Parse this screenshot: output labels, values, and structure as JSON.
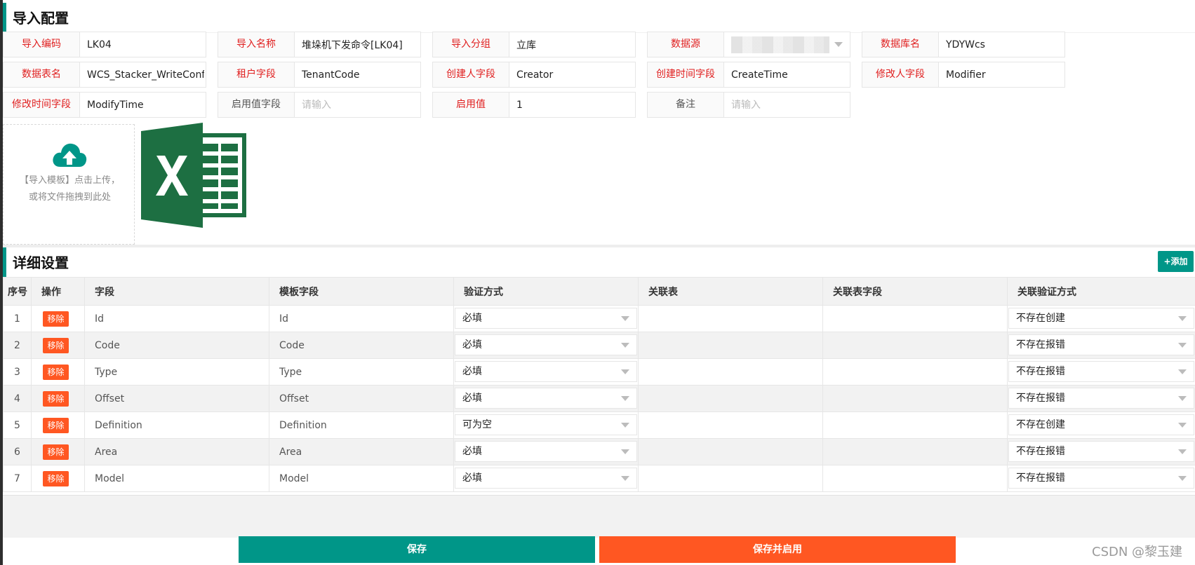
{
  "import_config": {
    "title": "导入配置",
    "fields": [
      {
        "label": "导入编码",
        "value": "LK04"
      },
      {
        "label": "导入名称",
        "value": "堆垛机下发命令[LK04]"
      },
      {
        "label": "导入分组",
        "value": "立库"
      },
      {
        "label": "数据源",
        "value": ""
      },
      {
        "label": "数据库名",
        "value": "YDYWcs"
      },
      {
        "label": "数据表名",
        "value": "WCS_Stacker_WriteConfig"
      },
      {
        "label": "租户字段",
        "value": "TenantCode"
      },
      {
        "label": "创建人字段",
        "value": "Creator"
      },
      {
        "label": "创建时间字段",
        "value": "CreateTime"
      },
      {
        "label": "修改人字段",
        "value": "Modifier"
      },
      {
        "label": "修改时间字段",
        "value": "ModifyTime"
      },
      {
        "label": "启用值字段",
        "value": "",
        "placeholder": "请输入"
      },
      {
        "label": "启用值",
        "value": "1"
      },
      {
        "label": "备注",
        "value": "",
        "placeholder": "请输入"
      }
    ]
  },
  "upload": {
    "text": "【导入模板】点击上传，或将文件拖拽到此处"
  },
  "detail": {
    "title": "详细设置",
    "add_label": "+添加",
    "columns": [
      "序号",
      "操作",
      "字段",
      "模板字段",
      "验证方式",
      "关联表",
      "关联表字段",
      "关联验证方式"
    ],
    "remove_label": "移除",
    "rows": [
      {
        "no": "1",
        "field": "Id",
        "template_field": "Id",
        "validate": "必填",
        "rel_table": "",
        "rel_field": "",
        "rel_validate": "不存在创建"
      },
      {
        "no": "2",
        "field": "Code",
        "template_field": "Code",
        "validate": "必填",
        "rel_table": "",
        "rel_field": "",
        "rel_validate": "不存在报错"
      },
      {
        "no": "3",
        "field": "Type",
        "template_field": "Type",
        "validate": "必填",
        "rel_table": "",
        "rel_field": "",
        "rel_validate": "不存在报错"
      },
      {
        "no": "4",
        "field": "Offset",
        "template_field": "Offset",
        "validate": "必填",
        "rel_table": "",
        "rel_field": "",
        "rel_validate": "不存在报错"
      },
      {
        "no": "5",
        "field": "Definition",
        "template_field": "Definition",
        "validate": "可为空",
        "rel_table": "",
        "rel_field": "",
        "rel_validate": "不存在创建"
      },
      {
        "no": "6",
        "field": "Area",
        "template_field": "Area",
        "validate": "必填",
        "rel_table": "",
        "rel_field": "",
        "rel_validate": "不存在报错"
      },
      {
        "no": "7",
        "field": "Model",
        "template_field": "Model",
        "validate": "必填",
        "rel_table": "",
        "rel_field": "",
        "rel_validate": "不存在报错"
      }
    ]
  },
  "actions": {
    "save": "保存",
    "save_enable": "保存并启用"
  },
  "watermark": "CSDN @黎玉建",
  "colors": {
    "primary": "#009688",
    "danger": "#ff5722",
    "required_label": "#e02020"
  }
}
